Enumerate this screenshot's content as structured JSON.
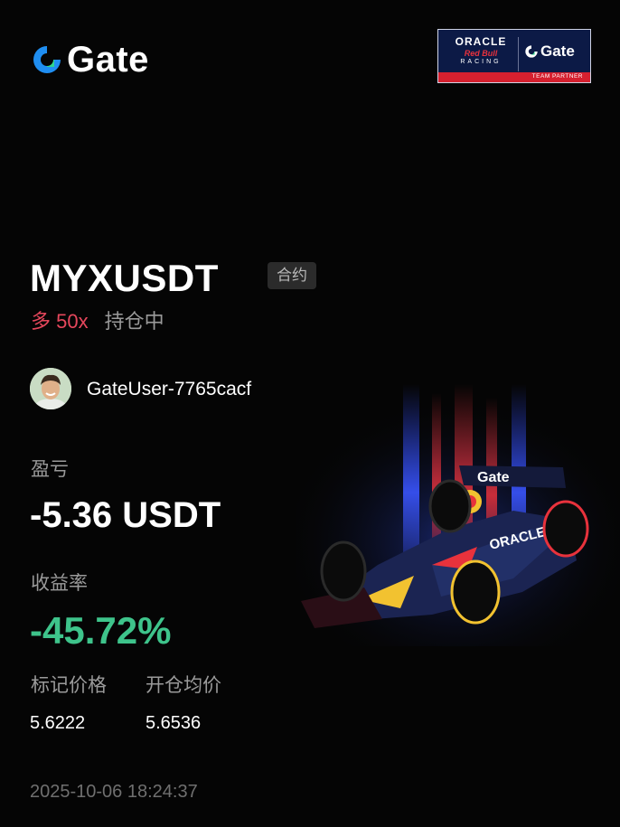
{
  "brand": {
    "logo_text": "Gate",
    "accent": "#1f8ef1"
  },
  "partner_badge": {
    "oracle": "ORACLE",
    "redbull": "Red Bull",
    "racing": "RACING",
    "gate": "Gate",
    "label": "TEAM PARTNER"
  },
  "position": {
    "pair": "MYXUSDT",
    "type_tag": "合约",
    "side_leverage": "多 50x",
    "status": "持仓中"
  },
  "user": {
    "name": "GateUser-7765cacf"
  },
  "stats": {
    "pnl_label": "盈亏",
    "pnl_value": "-5.36 USDT",
    "roi_label": "收益率",
    "roi_value": "-45.72%",
    "mark_price_label": "标记价格",
    "mark_price_value": "5.6222",
    "entry_price_label": "开仓均价",
    "entry_price_value": "5.6536"
  },
  "timestamp": "2025-10-06 18:24:37",
  "colors": {
    "long": "#e5475c",
    "profit_green": "#3ec48b",
    "muted": "#9a9a9a"
  }
}
